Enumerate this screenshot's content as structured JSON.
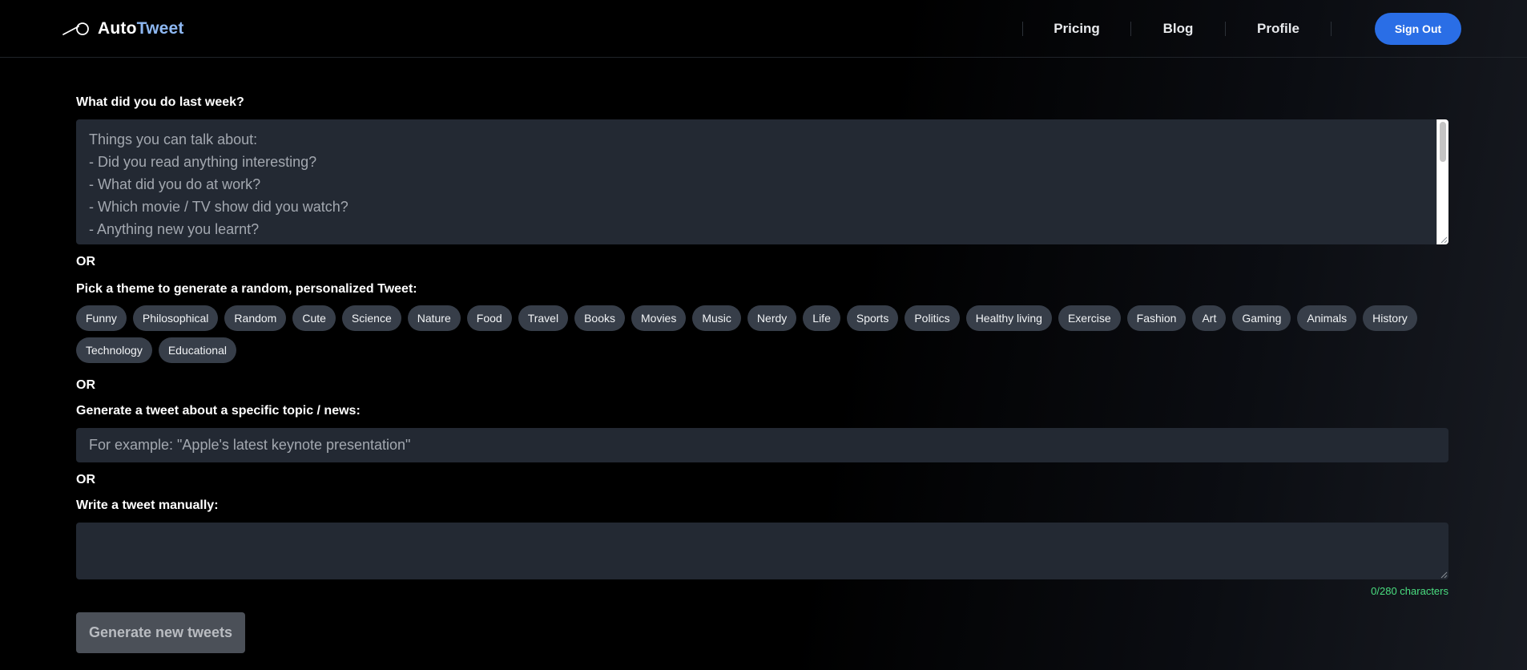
{
  "header": {
    "logo_prefix": "Auto",
    "logo_accent": "Tweet",
    "nav": [
      "Pricing",
      "Blog",
      "Profile"
    ],
    "sign_out_label": "Sign Out"
  },
  "last_week": {
    "label": "What did you do last week?",
    "placeholder": "Things you can talk about:\n- Did you read anything interesting?\n- What did you do at work?\n- Which movie / TV show did you watch?\n- Anything new you learnt?"
  },
  "or_label": "OR",
  "themes": {
    "label": "Pick a theme to generate a random, personalized Tweet:",
    "items": [
      "Funny",
      "Philosophical",
      "Random",
      "Cute",
      "Science",
      "Nature",
      "Food",
      "Travel",
      "Books",
      "Movies",
      "Music",
      "Nerdy",
      "Life",
      "Sports",
      "Politics",
      "Healthy living",
      "Exercise",
      "Fashion",
      "Art",
      "Gaming",
      "Animals",
      "History",
      "Technology",
      "Educational"
    ]
  },
  "topic": {
    "label": "Generate a tweet about a specific topic / news:",
    "placeholder": "For example: \"Apple's latest keynote presentation\""
  },
  "manual": {
    "label": "Write a tweet manually:",
    "value": "",
    "char_count": "0/280 characters"
  },
  "generate_label": "Generate new tweets",
  "colors": {
    "accent": "#2a6ee6",
    "logo_accent": "#8eb8f2",
    "counter": "#4ade80"
  }
}
